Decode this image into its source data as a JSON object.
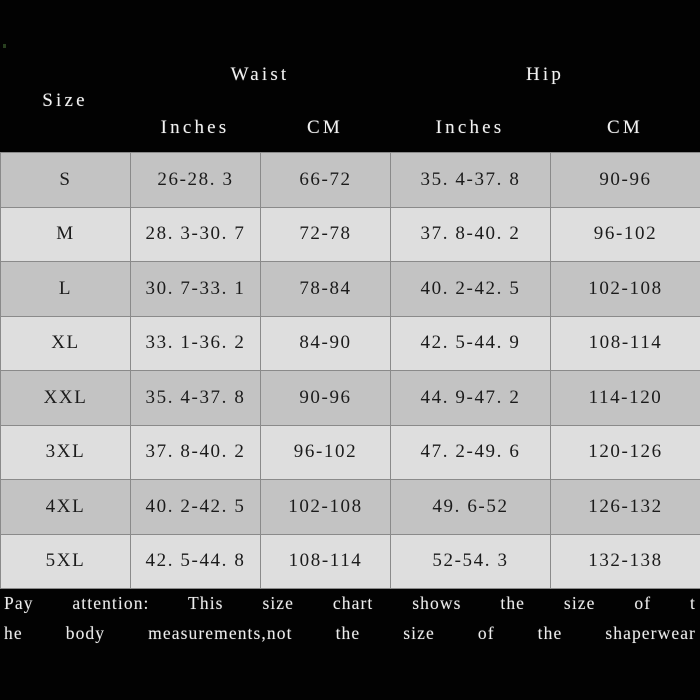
{
  "header": {
    "size_label": "Size",
    "waist_group": "Waist",
    "hip_group": "Hip",
    "waist_inches": "Inches",
    "waist_cm": "CM",
    "hip_inches": "Inches",
    "hip_cm": "CM"
  },
  "columns": [
    "Size",
    "Waist Inches",
    "Waist CM",
    "Hip Inches",
    "Hip CM"
  ],
  "rows": [
    {
      "size": "S",
      "waist_in": "26-28. 3",
      "waist_cm": "66-72",
      "hip_in": "35. 4-37. 8",
      "hip_cm": "90-96",
      "band": "dark"
    },
    {
      "size": "M",
      "waist_in": "28. 3-30. 7",
      "waist_cm": "72-78",
      "hip_in": "37. 8-40. 2",
      "hip_cm": "96-102",
      "band": "light"
    },
    {
      "size": "L",
      "waist_in": "30. 7-33. 1",
      "waist_cm": "78-84",
      "hip_in": "40. 2-42. 5",
      "hip_cm": "102-108",
      "band": "dark"
    },
    {
      "size": "XL",
      "waist_in": "33. 1-36. 2",
      "waist_cm": "84-90",
      "hip_in": "42. 5-44. 9",
      "hip_cm": "108-114",
      "band": "light"
    },
    {
      "size": "XXL",
      "waist_in": "35. 4-37. 8",
      "waist_cm": "90-96",
      "hip_in": "44. 9-47. 2",
      "hip_cm": "114-120",
      "band": "dark"
    },
    {
      "size": "3XL",
      "waist_in": "37. 8-40. 2",
      "waist_cm": "96-102",
      "hip_in": "47. 2-49. 6",
      "hip_cm": "120-126",
      "band": "light"
    },
    {
      "size": "4XL",
      "waist_in": "40. 2-42. 5",
      "waist_cm": "102-108",
      "hip_in": "49. 6-52",
      "hip_cm": "126-132",
      "band": "dark"
    },
    {
      "size": "5XL",
      "waist_in": "42. 5-44. 8",
      "waist_cm": "108-114",
      "hip_in": "52-54. 3",
      "hip_cm": "132-138",
      "band": "light"
    }
  ],
  "footer": {
    "line1": "Pay attention: This size chart shows the size of t",
    "line2": "he body measurements,not the size of the shaperwear",
    "full_text": "Pay attention: This size chart shows the size of the body measurements,not the size of the shaperwear"
  },
  "colors": {
    "background": "#020202",
    "band_dark": "#c3c3c3",
    "band_light": "#dedede",
    "grid_line": "#8a8a8a",
    "header_text": "#f2f2f2",
    "cell_text": "#1b1b1b"
  }
}
